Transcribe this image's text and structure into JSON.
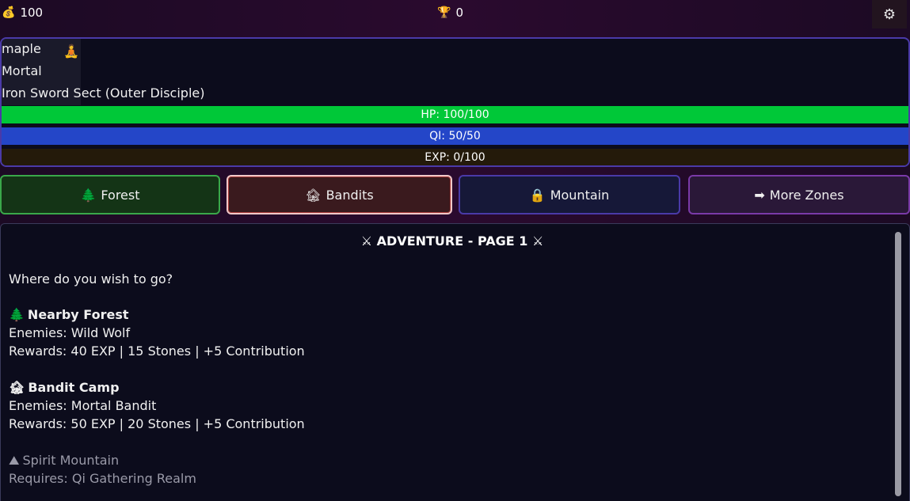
{
  "topbar": {
    "stones_icon": "money-bag-icon",
    "stones": "100",
    "trophy_icon": "trophy-icon",
    "trophies": "0",
    "settings_icon": "gear-icon"
  },
  "character": {
    "name": "maple",
    "avatar_icon": "meditating-person-icon",
    "realm": "Mortal",
    "sect": "Iron Sword Sect (Outer Disciple)",
    "hp": {
      "label": "HP: 100/100",
      "fraction": 1.0
    },
    "qi": {
      "label": "QI: 50/50",
      "fraction": 1.0
    },
    "exp": {
      "label": "EXP: 0/100",
      "fraction": 0.0
    }
  },
  "zone_buttons": [
    {
      "icon": "tree-icon",
      "glyph": "🌲",
      "label": "Forest"
    },
    {
      "icon": "house-icon",
      "glyph": "🏚",
      "label": "Bandits"
    },
    {
      "icon": "lock-icon",
      "glyph": "🔒",
      "label": "Mountain"
    },
    {
      "icon": "arrow-right-icon",
      "glyph": "➡",
      "label": "More Zones"
    }
  ],
  "adventure": {
    "title": "ADVENTURE - PAGE 1",
    "title_icon": "crossed-swords-icon",
    "prompt": "Where do you wish to go?",
    "zones": [
      {
        "icon": "tree-icon",
        "glyph": "🌲",
        "name": "Nearby Forest",
        "enemies": "Enemies: Wild Wolf",
        "rewards": "Rewards: 40 EXP | 15 Stones | +5 Contribution"
      },
      {
        "icon": "house-icon",
        "glyph": "🏚",
        "name": "Bandit Camp",
        "enemies": "Enemies: Mortal Bandit",
        "rewards": "Rewards: 50 EXP | 20 Stones | +5 Contribution"
      },
      {
        "icon": "mountain-icon",
        "glyph": "⛰",
        "name": "Spirit Mountain",
        "requires": "Requires: Qi Gathering Realm"
      }
    ]
  },
  "colors": {
    "hp": "#00c838",
    "qi": "#2446c8",
    "exp": "#c89a10",
    "panel_border": "#4a3aa8"
  }
}
